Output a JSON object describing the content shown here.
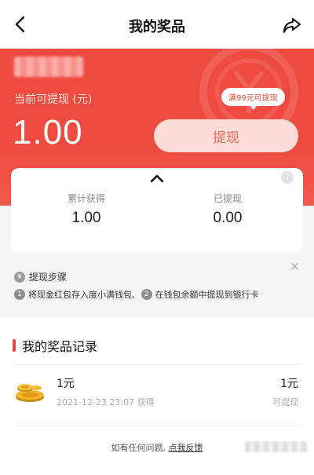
{
  "nav": {
    "title": "我的奖品",
    "back_icon": "back-arrow-icon",
    "share_icon": "share-icon"
  },
  "hero": {
    "balance_label": "当前可提现 (元)",
    "balance": "1.00",
    "withdraw_label": "提现",
    "tip": "满99元可提现",
    "bg_color": "#ef4a3f"
  },
  "summary": {
    "total_label": "累计获得",
    "total_value": "1.00",
    "withdrawn_label": "已提现",
    "withdrawn_value": "0.00",
    "help_symbol": "?"
  },
  "steps": {
    "title": "提现步骤",
    "yen_symbol": "¥",
    "step1_num": "1",
    "step1_text": "将现金红包存入度小满钱包,",
    "step2_num": "2",
    "step2_text": "在钱包余额中提现到银行卡",
    "close_symbol": "×"
  },
  "records": {
    "title": "我的奖品记录",
    "items": [
      {
        "title": "1元",
        "time": "2021-12-23 23:07 获得",
        "value": "1元",
        "status": "可提现"
      }
    ]
  },
  "footer": {
    "question": "如有任何问题,",
    "link": "点我反馈"
  },
  "accent_color": "#e8453b"
}
